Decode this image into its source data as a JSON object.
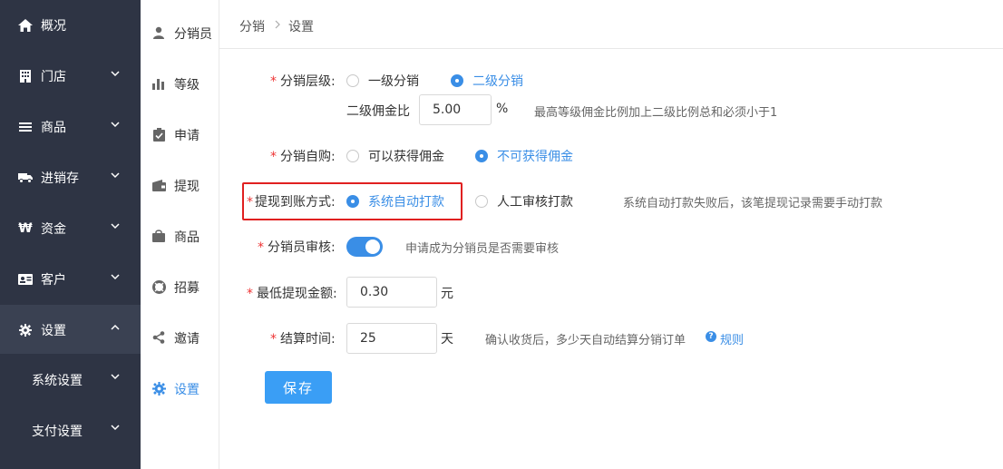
{
  "sidebar": {
    "items": [
      {
        "label": "概况"
      },
      {
        "label": "门店"
      },
      {
        "label": "商品"
      },
      {
        "label": "进销存"
      },
      {
        "label": "资金"
      },
      {
        "label": "客户"
      },
      {
        "label": "设置"
      }
    ],
    "sub_items": [
      {
        "label": "系统设置"
      },
      {
        "label": "支付设置"
      }
    ],
    "currency_glyph": "₩"
  },
  "sub_sidebar": {
    "items": [
      {
        "label": "分销员"
      },
      {
        "label": "等级"
      },
      {
        "label": "申请"
      },
      {
        "label": "提现"
      },
      {
        "label": "商品"
      },
      {
        "label": "招募"
      },
      {
        "label": "邀请"
      },
      {
        "label": "设置"
      }
    ]
  },
  "breadcrumb": {
    "items": [
      "分销",
      "设置"
    ]
  },
  "form": {
    "level": {
      "label": "分销层级:",
      "options": [
        "一级分销",
        "二级分销"
      ],
      "selected": "二级分销",
      "commission_label": "二级佣金比",
      "commission_value": "5.00",
      "commission_unit": "%",
      "commission_hint": "最高等级佣金比例加上二级比例总和必须小于1"
    },
    "self_purchase": {
      "label": "分销自购:",
      "options": [
        "可以获得佣金",
        "不可获得佣金"
      ],
      "selected": "不可获得佣金"
    },
    "withdraw_method": {
      "label": "提现到账方式:",
      "options": [
        "系统自动打款",
        "人工审核打款"
      ],
      "selected": "系统自动打款",
      "hint": "系统自动打款失败后，该笔提现记录需要手动打款"
    },
    "review": {
      "label": "分销员审核:",
      "enabled": true,
      "hint": "申请成为分销员是否需要审核"
    },
    "min_withdraw": {
      "label": "最低提现金额:",
      "value": "0.30",
      "unit": "元"
    },
    "settle_time": {
      "label": "结算时间:",
      "value": "25",
      "unit": "天",
      "hint": "确认收货后，多少天自动结算分销订单",
      "help_glyph": "?",
      "rule_link": "规则"
    },
    "required_mark": "*",
    "save_label": "保存"
  },
  "colors": {
    "sidebar_bg": "#2e3444",
    "accent": "#3a8ee6",
    "highlight": "#e02020"
  }
}
